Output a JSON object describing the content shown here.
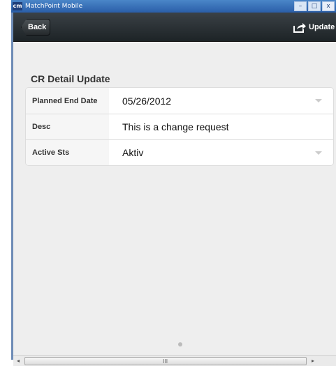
{
  "window": {
    "icon_label": "cm",
    "title": "MatchPoint Mobile",
    "minimize": "–",
    "maximize": "□",
    "close": "x"
  },
  "header": {
    "back_label": "Back",
    "update_label": "Update",
    "update_icon": "share-out-icon"
  },
  "form": {
    "title": "CR Detail Update",
    "rows": [
      {
        "label": "Planned End Date",
        "value": "05/26/2012",
        "dropdown": true
      },
      {
        "label": "Desc",
        "value": "This is a change request",
        "dropdown": false
      },
      {
        "label": "Active Sts",
        "value": "Aktiv",
        "dropdown": true
      }
    ]
  },
  "scrollbar": {
    "left_arrow": "◂",
    "right_arrow": "▸",
    "grip": "III"
  },
  "colors": {
    "header_bg": "#262c2f",
    "content_bg": "#eeeeee",
    "titlebar_bg": "#3b74be"
  }
}
